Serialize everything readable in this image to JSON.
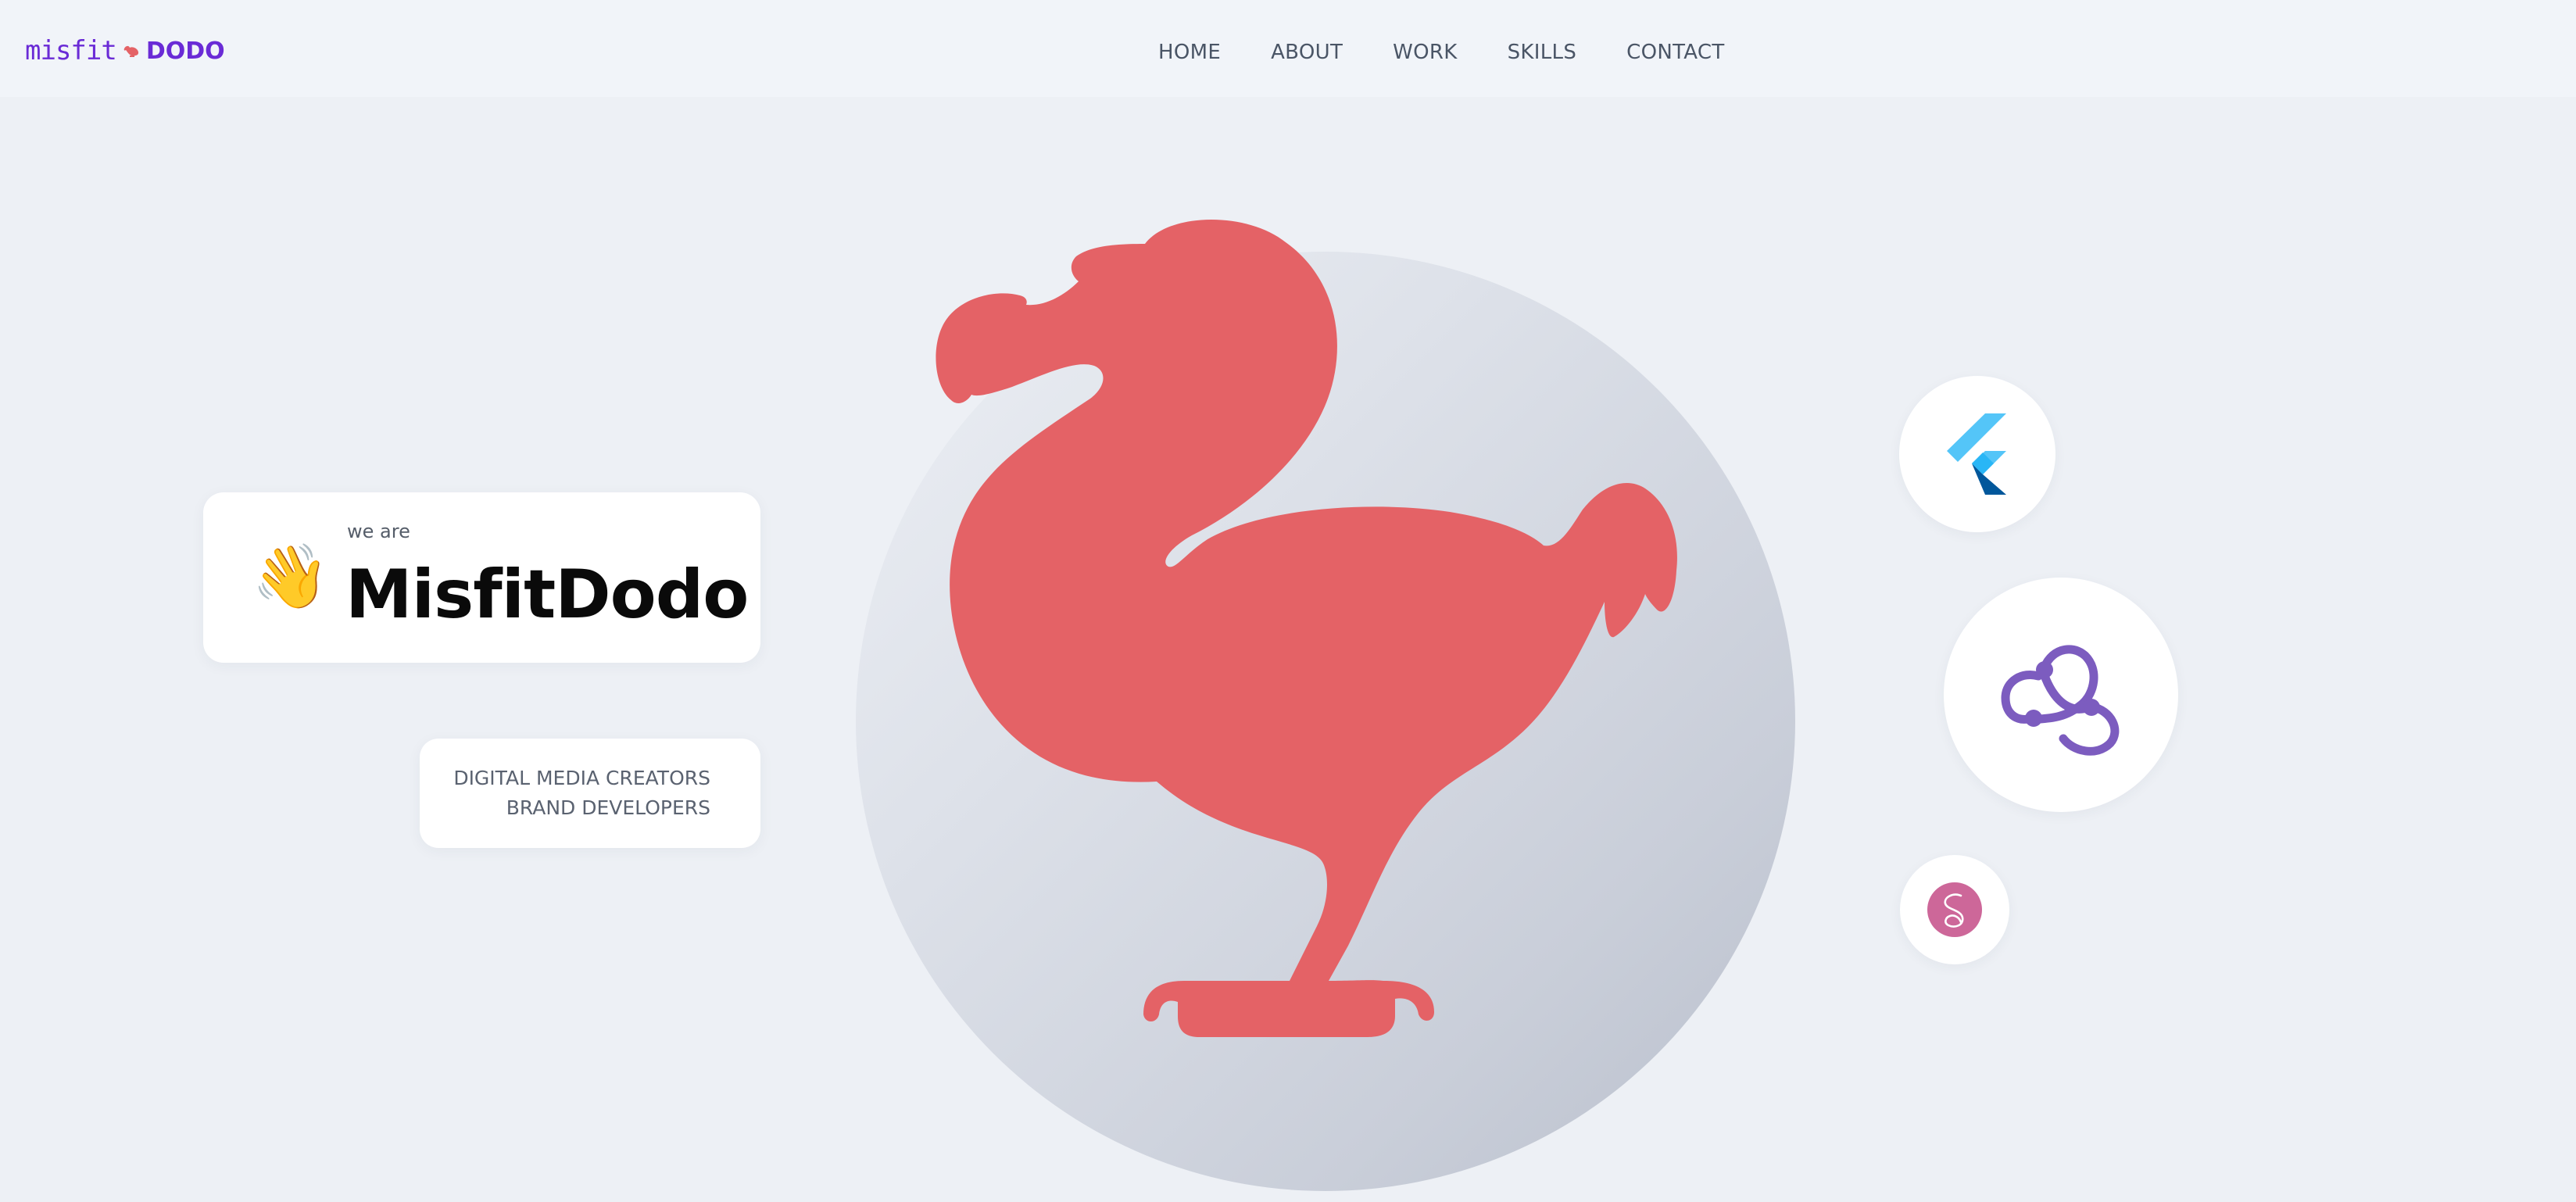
{
  "header": {
    "logo_left": "misfit",
    "logo_right": "DODO",
    "nav": [
      {
        "label": "HOME"
      },
      {
        "label": "ABOUT"
      },
      {
        "label": "WORK"
      },
      {
        "label": "SKILLS"
      },
      {
        "label": "CONTACT"
      }
    ]
  },
  "hero": {
    "intro": {
      "wave_emoji": "👋",
      "kicker": "we are",
      "name": "MisfitDodo"
    },
    "tagline": {
      "line1": "DIGITAL MEDIA CREATORS",
      "line2": "BRAND DEVELOPERS"
    },
    "illustration": "dodo-bird-silhouette",
    "tech_icons": [
      "flutter-icon",
      "redux-icon",
      "sass-icon"
    ]
  },
  "colors": {
    "background": "#edf0f5",
    "header_bg": "#f1f4f9",
    "logo": "#6a2bd6",
    "dodo": "#e46266",
    "nav_text": "#4a5566",
    "redux": "#7c5cbf",
    "sass": "#cd6799",
    "flutter_light": "#54c5f8",
    "flutter_dark": "#01579b"
  }
}
